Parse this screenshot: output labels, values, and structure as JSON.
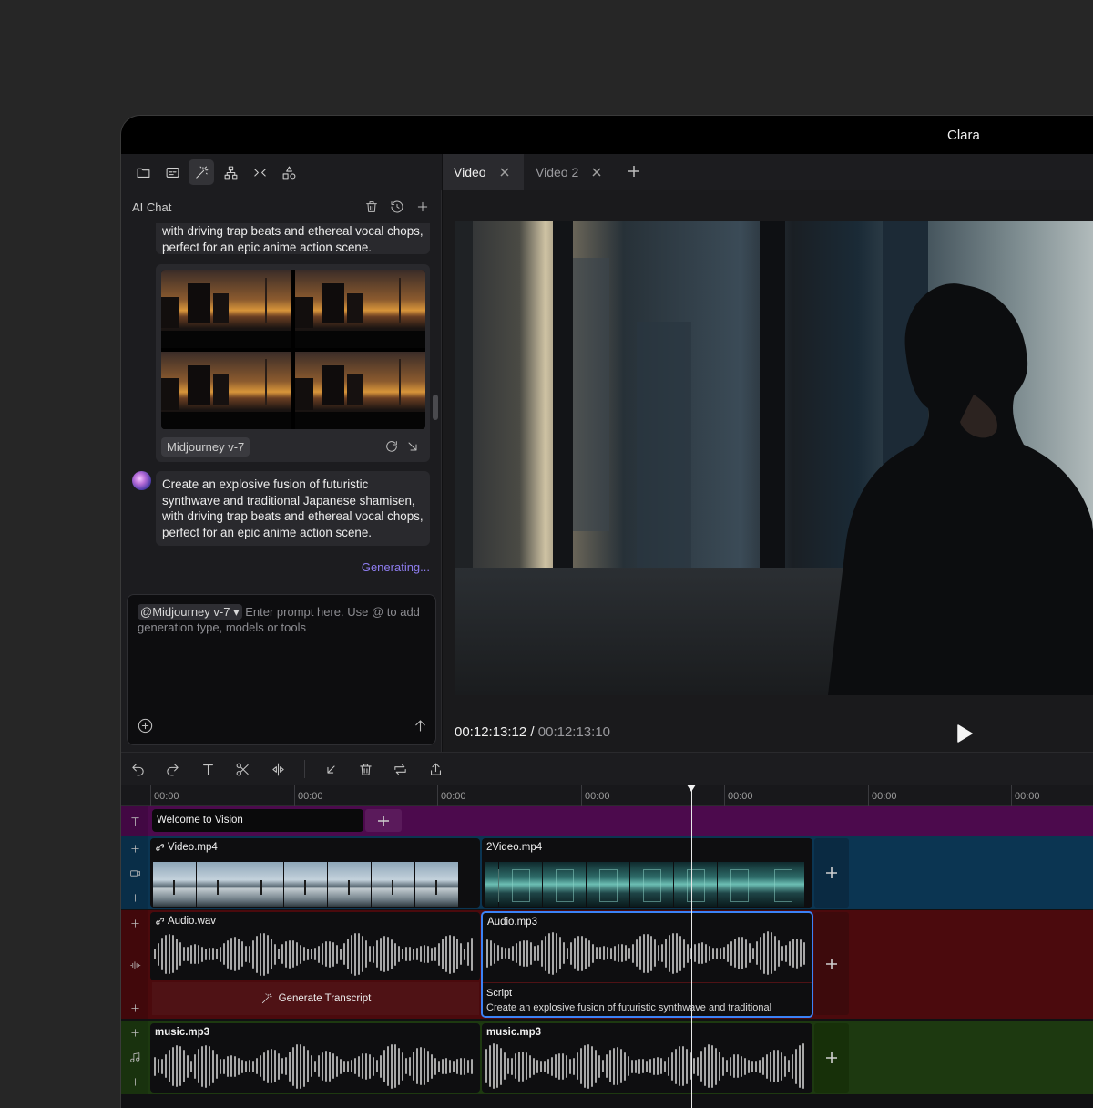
{
  "app": {
    "title": "Clara"
  },
  "left_toolbar": {
    "icons": [
      "folder-icon",
      "captions-icon",
      "magic-wand-icon",
      "hierarchy-icon",
      "collapse-icon",
      "shapes-icon"
    ]
  },
  "chat": {
    "header": "AI Chat",
    "message1_tail": "with driving trap beats and ethereal vocal chops, perfect for an epic anime action scene.",
    "image_card": {
      "model": "Midjourney v-7"
    },
    "message2": "Create an explosive fusion of futuristic synthwave and traditional Japanese shamisen, with driving trap beats and ethereal vocal chops, perfect for an epic anime action scene.",
    "status": "Generating...",
    "prompt": {
      "mention": "@Midjourney v-7",
      "placeholder": "Enter prompt here. Use @ to add generation type, models or tools"
    }
  },
  "tabs": [
    {
      "label": "Video",
      "active": true
    },
    {
      "label": "Video 2",
      "active": false
    }
  ],
  "player": {
    "current_time": "00:12:13:12",
    "separator": "/",
    "total_time": "00:12:13:10"
  },
  "ruler": {
    "labels": [
      "00:00",
      "00:00",
      "00:00",
      "00:00",
      "00:00",
      "00:00",
      "00:00"
    ]
  },
  "timeline": {
    "text_track": {
      "clip_label": "Welcome to Vision"
    },
    "video_track": {
      "clips": [
        "Video.mp4",
        "2Video.mp4"
      ]
    },
    "audio_track": {
      "clips": [
        "Audio.wav",
        "Audio.mp3"
      ],
      "generate_label": "Generate Transcript",
      "script_heading": "Script",
      "script_text": "Create an explosive fusion of futuristic synthwave and traditional"
    },
    "music_track": {
      "clips": [
        "music.mp3",
        "music.mp3"
      ]
    }
  },
  "colors": {
    "accent": "#3b82f6",
    "generating": "#8e7df0",
    "text_track": "#4c0a4d",
    "video_track": "#0b3552",
    "audio_track": "#4b0a0d",
    "music_track": "#1d3910"
  }
}
